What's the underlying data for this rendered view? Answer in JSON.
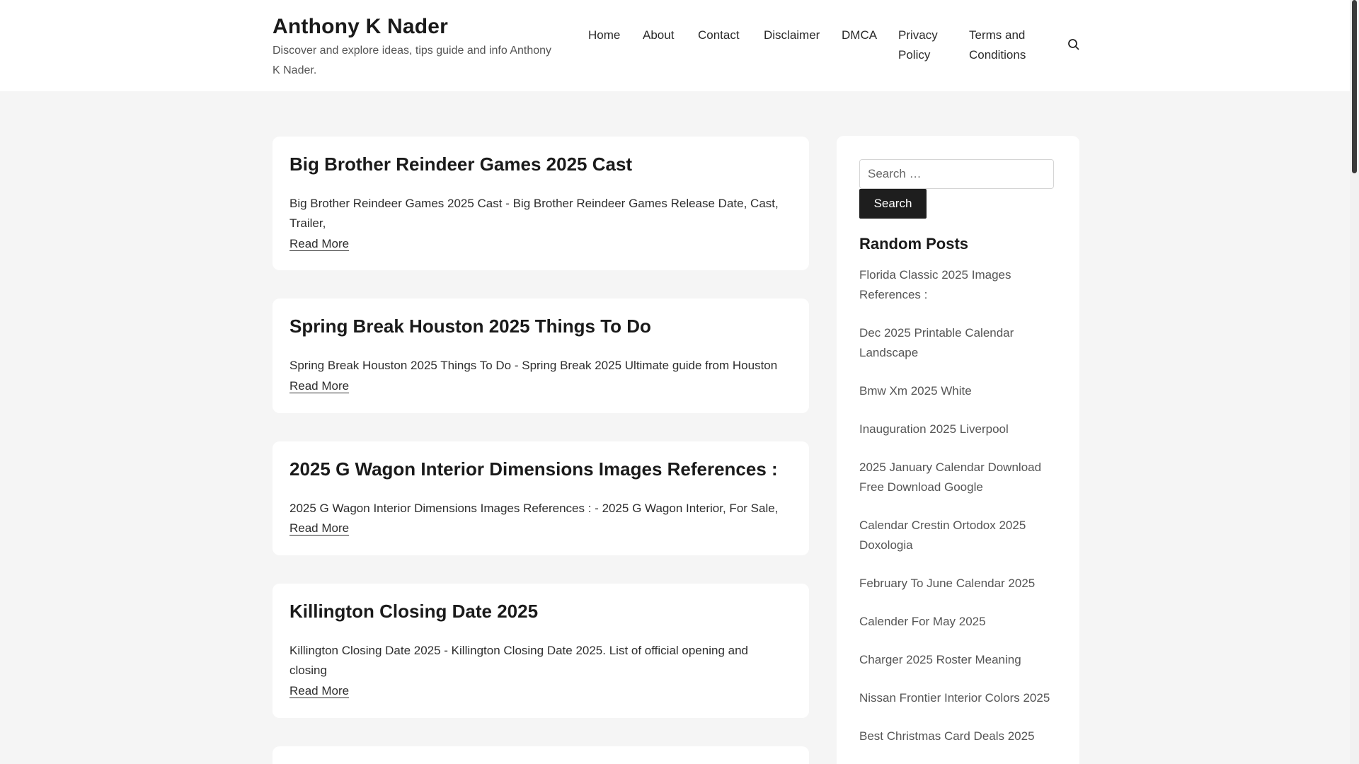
{
  "site": {
    "title": "Anthony K Nader",
    "description": "Discover and explore ideas, tips guide and info Anthony K Nader."
  },
  "nav": {
    "home": "Home",
    "about": "About",
    "contact": "Contact",
    "disclaimer": "Disclaimer",
    "dmca": "DMCA",
    "privacy": "Privacy Policy",
    "terms": "Terms and Conditions"
  },
  "posts": [
    {
      "title": "Big Brother Reindeer Games 2025 Cast",
      "excerpt": "Big Brother Reindeer Games 2025 Cast - Big Brother Reindeer Games Release Date, Cast, Trailer,",
      "read_more": "Read More"
    },
    {
      "title": "Spring Break Houston 2025 Things To Do",
      "excerpt": "Spring Break Houston 2025 Things To Do - Spring Break 2025 Ultimate guide from Houston",
      "read_more": "Read More"
    },
    {
      "title": "2025 G Wagon Interior Dimensions Images References :",
      "excerpt": "2025 G Wagon Interior Dimensions Images References : - 2025 G Wagon Interior, For Sale,",
      "read_more": "Read More"
    },
    {
      "title": "Killington Closing Date 2025",
      "excerpt": "Killington Closing Date 2025 - Killington Closing Date 2025. List of official opening and closing",
      "read_more": "Read More"
    }
  ],
  "sidebar": {
    "search_placeholder": "Search …",
    "search_button": "Search",
    "random_title": "Random Posts",
    "random_posts": [
      "Florida Classic 2025 Images References :",
      "Dec 2025 Printable Calendar Landscape",
      "Bmw Xm 2025 White",
      "Inauguration 2025 Liverpool",
      "2025 January Calendar Download Free Download Google",
      "Calendar Crestin Ortodox 2025 Doxologia",
      "February To June Calendar 2025",
      "Calender For May 2025",
      "Charger 2025 Roster Meaning",
      "Nissan Frontier Interior Colors 2025",
      "Best Christmas Card Deals 2025"
    ]
  }
}
